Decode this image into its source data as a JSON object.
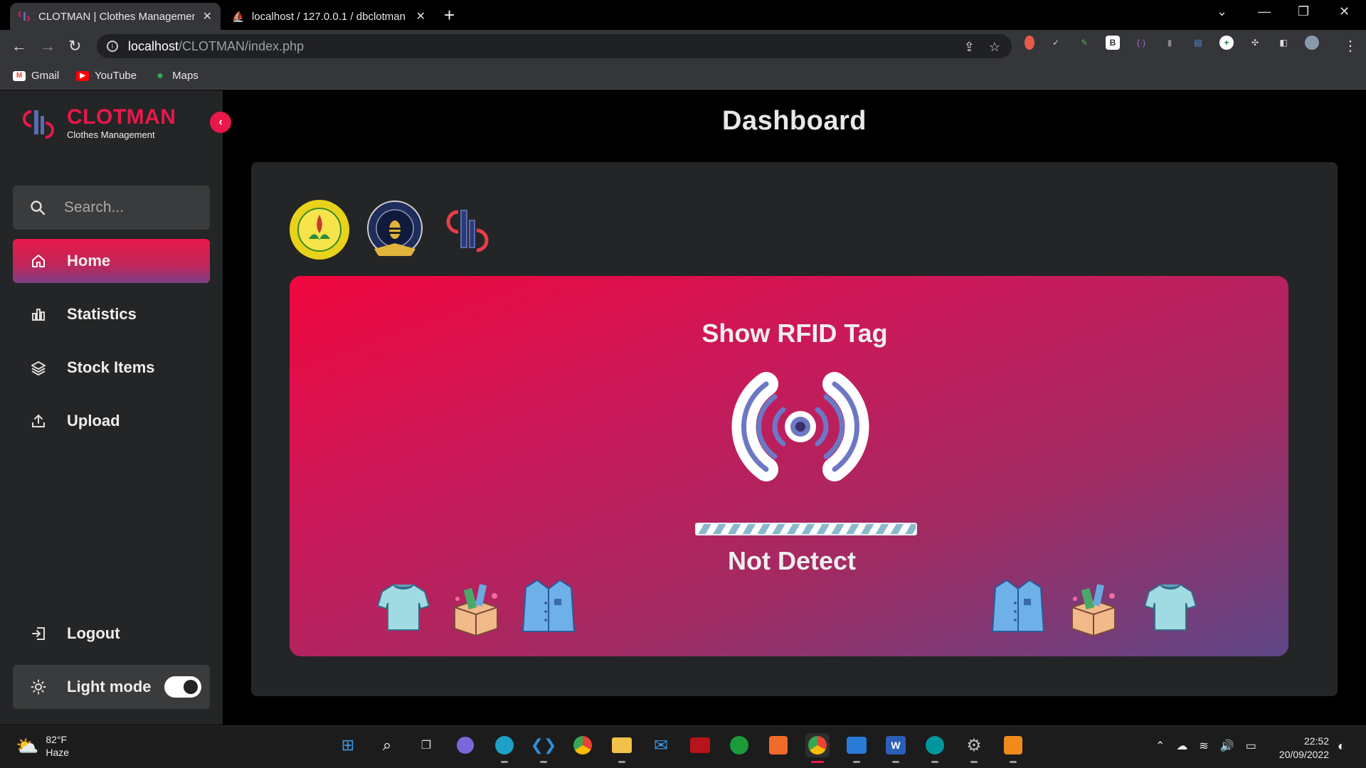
{
  "browser": {
    "tabs": [
      {
        "title": "CLOTMAN | Clothes Management",
        "active": true
      },
      {
        "title": "localhost / 127.0.0.1 / dbclotman",
        "active": false
      }
    ],
    "url_host": "localhost",
    "url_path": "/CLOTMAN/index.php",
    "bookmarks": [
      "Gmail",
      "YouTube",
      "Maps"
    ]
  },
  "app": {
    "logo_title": "CLOTMAN",
    "logo_subtitle": "Clothes Management",
    "search_placeholder": "Search...",
    "nav": [
      {
        "label": "Home",
        "icon": "home-icon",
        "active": true
      },
      {
        "label": "Statistics",
        "icon": "bar-chart-icon",
        "active": false
      },
      {
        "label": "Stock Items",
        "icon": "layers-icon",
        "active": false
      },
      {
        "label": "Upload",
        "icon": "upload-icon",
        "active": false
      }
    ],
    "logout_label": "Logout",
    "mode_label": "Light mode",
    "mode_toggle_on": true
  },
  "dashboard": {
    "title": "Dashboard",
    "card_title": "Show RFID Tag",
    "status": "Not Detect",
    "accent": "#e8194a"
  },
  "taskbar": {
    "temperature": "82°F",
    "condition": "Haze",
    "time": "22:52",
    "date": "20/09/2022"
  }
}
